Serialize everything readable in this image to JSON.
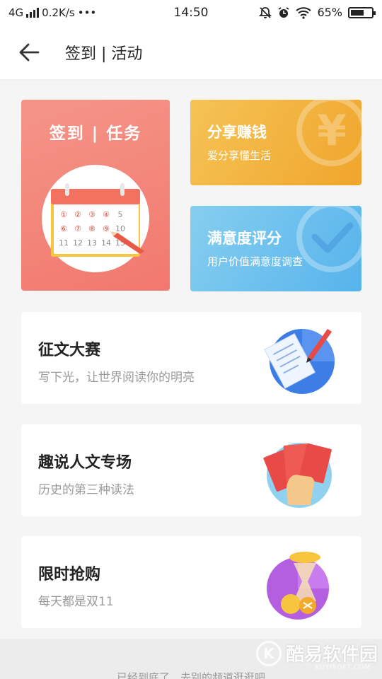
{
  "status_bar": {
    "network": "4G",
    "speed": "0.2K/s",
    "dots": "•••",
    "time": "14:50",
    "battery": "65%",
    "battery_level": 0.65
  },
  "header": {
    "title": "签到 | 活动"
  },
  "checkin_card": {
    "title": "签到 | 任务",
    "calendar_rows": [
      [
        "①",
        "②",
        "③",
        "④",
        "5"
      ],
      [
        "⑥",
        "⑦",
        "⑧",
        "⑨",
        "10"
      ],
      [
        "11",
        "12",
        "13",
        "14",
        "15"
      ]
    ]
  },
  "share_card": {
    "title": "分享赚钱",
    "subtitle": "爱分享懂生活",
    "deco_glyph": "¥"
  },
  "rate_card": {
    "title": "满意度评分",
    "subtitle": "用户价值满意度调查"
  },
  "list": [
    {
      "title": "征文大赛",
      "subtitle": "写下光，让世界阅读你的明亮"
    },
    {
      "title": "趣说人文专场",
      "subtitle": "历史的第三种读法"
    },
    {
      "title": "限时抢购",
      "subtitle": "每天都是双11"
    }
  ],
  "footer": {
    "text": "已经到底了，去别的频道逛逛吧"
  },
  "watermark": {
    "logo": "K",
    "text": "酷易软件园",
    "sub": "KUYISOFT.COM"
  },
  "colors": {
    "checkin": "#f2786e",
    "share": "#f0a52c",
    "rate": "#56b3ec"
  }
}
